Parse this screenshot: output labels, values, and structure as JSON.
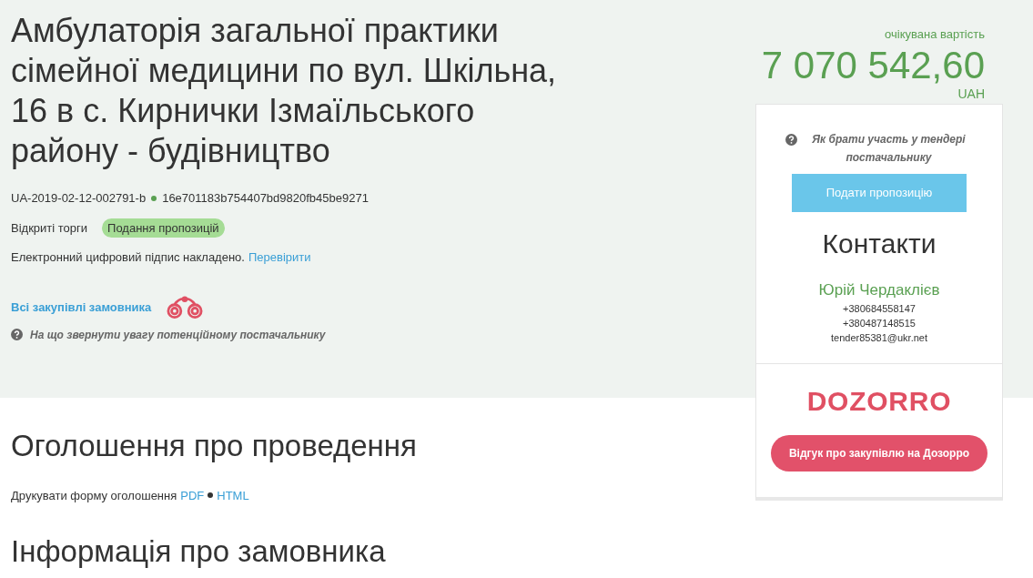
{
  "title": "Амбулаторія загальної практики сімейної медицини по вул. Шкільна, 16 в с. Кирнички Ізмаїльського району - будівництво",
  "tender_id": "UA-2019-02-12-002791-b",
  "tender_hash": "16e701183b754407bd9820fb45be9271",
  "procedure": "Відкриті торги",
  "status_badge": "Подання пропозицій",
  "signature": {
    "text": "Електронний цифровий підпис накладено.",
    "link": "Перевірити"
  },
  "customer_link": "Всі закупівлі замовника",
  "hint": "На що звернути увагу потенційному постачальнику",
  "price": {
    "label": "очікувана вартість",
    "amount": "7 070 542,60",
    "currency": "UAH"
  },
  "sidebar": {
    "help": "Як брати участь у тендері постачальнику",
    "submit_button": "Подати пропозицію",
    "contacts_title": "Контакти",
    "contact_name": "Юрій Чердаклієв",
    "phones": [
      "+380684558147",
      "+380487148515"
    ],
    "email": "tender85381@ukr.net",
    "logo": "DOZORRO",
    "feedback_button": "Відгук про закупівлю на Дозорро"
  },
  "announcement": {
    "title": "Оголошення про проведення",
    "print_label": "Друкувати форму оголошення",
    "formats": [
      "PDF",
      "HTML"
    ]
  },
  "customer_section": {
    "title": "Інформація про замовника"
  }
}
